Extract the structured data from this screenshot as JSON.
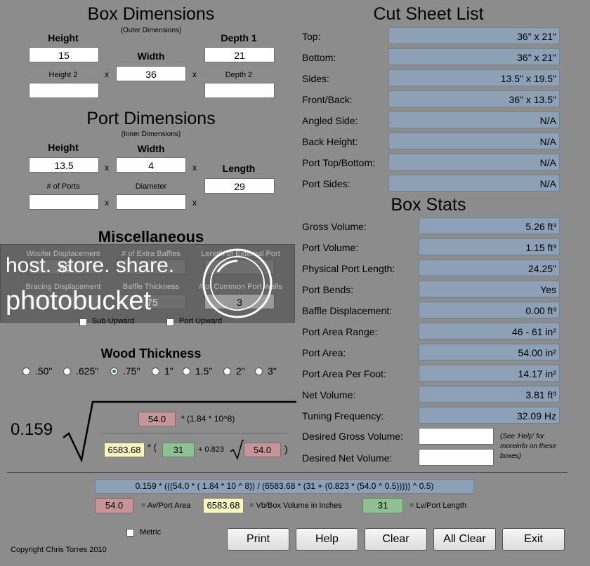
{
  "box": {
    "title": "Box Dimensions",
    "subtitle": "(Outer Dimensions)",
    "height_label": "Height",
    "height": "15",
    "width_label": "Width",
    "width": "36",
    "depth1_label": "Depth 1",
    "depth1": "21",
    "height2_label": "Height 2",
    "height2": "",
    "depth2_label": "Depth 2",
    "depth2": "",
    "times": "x"
  },
  "port": {
    "title": "Port Dimensions",
    "subtitle": "(Inner Dimensions)",
    "height_label": "Height",
    "height": "13.5",
    "width_label": "Width",
    "width": "4",
    "length_label": "Length",
    "length": "29",
    "ports_label": "# of Ports",
    "ports": "",
    "diameter_label": "Diameter",
    "diameter": ""
  },
  "misc": {
    "title": "Miscellaneous",
    "woofer_label": "Woofer Displacement",
    "woofer": ".80",
    "baffles_label": "# of Extra Baffles",
    "baffles": "",
    "ext_port_label": "Length of External Port",
    "ext_port": "",
    "bracing_label": "Bracing Displacement",
    "bracing": "",
    "baffle_thick_label": "Baffle Thickness",
    "baffle_thick": ".75",
    "common_walls_label": "# of Common Port Walls",
    "common_walls": "3",
    "sub_upward": "Sub Upward",
    "port_upward": "Port Upward",
    "watermark_line1": "host. store. share.",
    "watermark_line2": "photobucket"
  },
  "wood": {
    "title": "Wood Thickness",
    "options": [
      ".50\"",
      ".625\"",
      ".75\"",
      "1\"",
      "1.5\"",
      "2\"",
      "3\""
    ],
    "selected": ".75\""
  },
  "formula": {
    "coef": "0.159",
    "av_top": "54.0",
    "top_text": "* (1.84 * 10^8)",
    "vb": "6583.68",
    "mul_paren": "* (",
    "lv": "31",
    "plus": "+ 0.823",
    "av_bottom": "54.0",
    "close": ")",
    "expression": "0.159 * (((54.0 * ( 1.84 * 10 ^ 8)) / (6583.68 * (31 + (0.823 * (54.0 ^ 0.5))))) ^ 0.5)",
    "legend_av": "54.0",
    "legend_av_text": "= Av/Port Area",
    "legend_vb": "6583.68",
    "legend_vb_text": "= Vb/Box Volume in Inches",
    "legend_lv": "31",
    "legend_lv_text": "= Lv/Port Length"
  },
  "cut": {
    "title": "Cut Sheet List",
    "rows": [
      {
        "label": "Top:",
        "value": "36\" x 21\""
      },
      {
        "label": "Bottom:",
        "value": "36\" x 21\""
      },
      {
        "label": "Sides:",
        "value": "13.5\" x 19.5\""
      },
      {
        "label": "Front/Back:",
        "value": "36\" x 13.5\""
      },
      {
        "label": "Angled Side:",
        "value": "N/A"
      },
      {
        "label": "Back Height:",
        "value": "N/A"
      },
      {
        "label": "Port Top/Bottom:",
        "value": "N/A"
      },
      {
        "label": "Port Sides:",
        "value": "N/A"
      }
    ]
  },
  "stats": {
    "title": "Box Stats",
    "rows": [
      {
        "label": "Gross Volume:",
        "value": "5.26 ft³"
      },
      {
        "label": "Port Volume:",
        "value": "1.15 ft³"
      },
      {
        "label": "Physical Port Length:",
        "value": "24.25\""
      },
      {
        "label": "Port Bends:",
        "value": "Yes"
      },
      {
        "label": "Baffle Displacement:",
        "value": "0.00 ft³"
      },
      {
        "label": "Port Area Range:",
        "value": "46 - 61 in²"
      },
      {
        "label": "Port Area:",
        "value": "54.00 in²"
      },
      {
        "label": "Port Area Per Foot:",
        "value": "14.17 in²"
      },
      {
        "label": "Net Volume:",
        "value": "3.81 ft³"
      },
      {
        "label": "Tuning Frequency:",
        "value": "32.09 Hz"
      }
    ],
    "desired_gross_label": "Desired Gross Volume:",
    "desired_gross": "",
    "desired_net_label": "Desired Net Volume:",
    "desired_net": "",
    "help_note": "(See 'Help' for moreinfo on these boxes)"
  },
  "footer": {
    "metric": "Metric",
    "copyright": "Copyright Chris Torres 2010",
    "buttons": [
      "Print",
      "Help",
      "Clear",
      "All Clear",
      "Exit"
    ]
  }
}
